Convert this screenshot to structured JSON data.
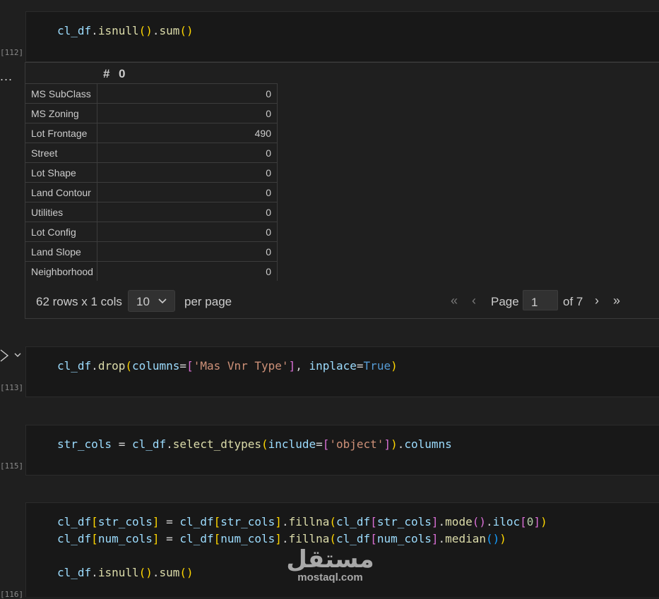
{
  "cells": [
    {
      "exec_count": "[112]",
      "code_line": [
        {
          "t": "cl_df",
          "c": "tok-var"
        },
        {
          "t": ".",
          "c": "tok-plain"
        },
        {
          "t": "isnull",
          "c": "tok-fn"
        },
        {
          "t": "()",
          "c": "tok-br1"
        },
        {
          "t": ".",
          "c": "tok-plain"
        },
        {
          "t": "sum",
          "c": "tok-fn"
        },
        {
          "t": "()",
          "c": "tok-br1"
        }
      ]
    },
    {
      "exec_count": "[113]",
      "code_line": [
        {
          "t": "cl_df",
          "c": "tok-var"
        },
        {
          "t": ".",
          "c": "tok-plain"
        },
        {
          "t": "drop",
          "c": "tok-fn"
        },
        {
          "t": "(",
          "c": "tok-br1"
        },
        {
          "t": "columns",
          "c": "tok-var"
        },
        {
          "t": "=",
          "c": "tok-op"
        },
        {
          "t": "[",
          "c": "tok-br2"
        },
        {
          "t": "'Mas Vnr Type'",
          "c": "tok-str"
        },
        {
          "t": "]",
          "c": "tok-br2"
        },
        {
          "t": ", ",
          "c": "tok-plain"
        },
        {
          "t": "inplace",
          "c": "tok-var"
        },
        {
          "t": "=",
          "c": "tok-op"
        },
        {
          "t": "True",
          "c": "tok-kw"
        },
        {
          "t": ")",
          "c": "tok-br1"
        }
      ]
    },
    {
      "exec_count": "[115]",
      "code_line": [
        {
          "t": "str_cols",
          "c": "tok-var"
        },
        {
          "t": " = ",
          "c": "tok-op"
        },
        {
          "t": "cl_df",
          "c": "tok-var"
        },
        {
          "t": ".",
          "c": "tok-plain"
        },
        {
          "t": "select_dtypes",
          "c": "tok-fn"
        },
        {
          "t": "(",
          "c": "tok-br1"
        },
        {
          "t": "include",
          "c": "tok-var"
        },
        {
          "t": "=",
          "c": "tok-op"
        },
        {
          "t": "[",
          "c": "tok-br2"
        },
        {
          "t": "'object'",
          "c": "tok-str"
        },
        {
          "t": "]",
          "c": "tok-br2"
        },
        {
          "t": ")",
          "c": "tok-br1"
        },
        {
          "t": ".",
          "c": "tok-plain"
        },
        {
          "t": "columns",
          "c": "tok-var"
        }
      ]
    },
    {
      "exec_count": "[116]",
      "code_line_1": [
        {
          "t": "cl_df",
          "c": "tok-var"
        },
        {
          "t": "[",
          "c": "tok-br1"
        },
        {
          "t": "str_cols",
          "c": "tok-var"
        },
        {
          "t": "]",
          "c": "tok-br1"
        },
        {
          "t": " = ",
          "c": "tok-op"
        },
        {
          "t": "cl_df",
          "c": "tok-var"
        },
        {
          "t": "[",
          "c": "tok-br1"
        },
        {
          "t": "str_cols",
          "c": "tok-var"
        },
        {
          "t": "]",
          "c": "tok-br1"
        },
        {
          "t": ".",
          "c": "tok-plain"
        },
        {
          "t": "fillna",
          "c": "tok-fn"
        },
        {
          "t": "(",
          "c": "tok-br1"
        },
        {
          "t": "cl_df",
          "c": "tok-var"
        },
        {
          "t": "[",
          "c": "tok-br2"
        },
        {
          "t": "str_cols",
          "c": "tok-var"
        },
        {
          "t": "]",
          "c": "tok-br2"
        },
        {
          "t": ".",
          "c": "tok-plain"
        },
        {
          "t": "mode",
          "c": "tok-fn"
        },
        {
          "t": "()",
          "c": "tok-br2"
        },
        {
          "t": ".",
          "c": "tok-plain"
        },
        {
          "t": "iloc",
          "c": "tok-var"
        },
        {
          "t": "[",
          "c": "tok-br2"
        },
        {
          "t": "0",
          "c": "tok-num"
        },
        {
          "t": "]",
          "c": "tok-br2"
        },
        {
          "t": ")",
          "c": "tok-br1"
        }
      ],
      "code_line_2": [
        {
          "t": "cl_df",
          "c": "tok-var"
        },
        {
          "t": "[",
          "c": "tok-br1"
        },
        {
          "t": "num_cols",
          "c": "tok-var"
        },
        {
          "t": "]",
          "c": "tok-br1"
        },
        {
          "t": " = ",
          "c": "tok-op"
        },
        {
          "t": "cl_df",
          "c": "tok-var"
        },
        {
          "t": "[",
          "c": "tok-br1"
        },
        {
          "t": "num_cols",
          "c": "tok-var"
        },
        {
          "t": "]",
          "c": "tok-br1"
        },
        {
          "t": ".",
          "c": "tok-plain"
        },
        {
          "t": "fillna",
          "c": "tok-fn"
        },
        {
          "t": "(",
          "c": "tok-br1"
        },
        {
          "t": "cl_df",
          "c": "tok-var"
        },
        {
          "t": "[",
          "c": "tok-br2"
        },
        {
          "t": "num_cols",
          "c": "tok-var"
        },
        {
          "t": "]",
          "c": "tok-br2"
        },
        {
          "t": ".",
          "c": "tok-plain"
        },
        {
          "t": "median",
          "c": "tok-fn"
        },
        {
          "t": "()",
          "c": "tok-br3"
        },
        {
          "t": ")",
          "c": "tok-br1"
        }
      ],
      "code_line_3": [
        {
          "t": "cl_df",
          "c": "tok-var"
        },
        {
          "t": ".",
          "c": "tok-plain"
        },
        {
          "t": "isnull",
          "c": "tok-fn"
        },
        {
          "t": "()",
          "c": "tok-br1"
        },
        {
          "t": ".",
          "c": "tok-plain"
        },
        {
          "t": "sum",
          "c": "tok-fn"
        },
        {
          "t": "()",
          "c": "tok-br1"
        }
      ]
    }
  ],
  "output": {
    "more_label": "...",
    "header_hash": "#",
    "header_col": "0",
    "rows": [
      {
        "idx": "MS SubClass",
        "val": "0"
      },
      {
        "idx": "MS Zoning",
        "val": "0"
      },
      {
        "idx": "Lot Frontage",
        "val": "490"
      },
      {
        "idx": "Street",
        "val": "0"
      },
      {
        "idx": "Lot Shape",
        "val": "0"
      },
      {
        "idx": "Land Contour",
        "val": "0"
      },
      {
        "idx": "Utilities",
        "val": "0"
      },
      {
        "idx": "Lot Config",
        "val": "0"
      },
      {
        "idx": "Land Slope",
        "val": "0"
      },
      {
        "idx": "Neighborhood",
        "val": "0"
      }
    ],
    "pager": {
      "rows_info": "62 rows x 1 cols",
      "per_page_value": "10",
      "per_page_label": "per page",
      "page_label": "Page",
      "page_value": "1",
      "of_label": "of 7"
    }
  },
  "icons": {
    "first": "«",
    "prev": "‹",
    "next": "›",
    "last": "»",
    "chevron": "⌄",
    "run": "▷",
    "expand": "⌄"
  },
  "watermark": {
    "arabic": "مستقل",
    "latin": "mostaql.com"
  }
}
